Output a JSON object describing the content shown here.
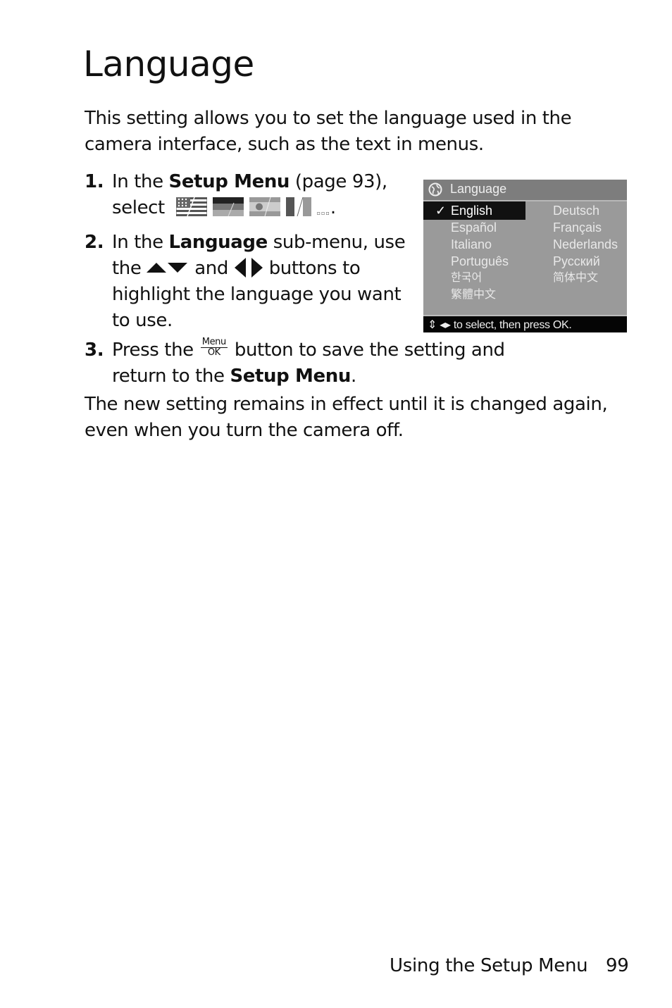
{
  "page": {
    "title": "Language",
    "intro": "This setting allows you to set the language used in the camera interface, such as the text in menus.",
    "steps": [
      {
        "num": "1.",
        "parts": {
          "a": "In the ",
          "b": "Setup Menu",
          "c": " (page 93),",
          "d": "select",
          "e": "."
        },
        "icons": [
          "us-flag-icon",
          "german-flag-icon",
          "japan-flag-icon",
          "french-flag-icon",
          "more-dots-icon"
        ]
      },
      {
        "num": "2.",
        "parts": {
          "a": "In the ",
          "b": "Language",
          "c": " sub-menu, use the",
          "d": "and",
          "e": "buttons to highlight the language you want to use."
        }
      },
      {
        "num": "3.",
        "parts": {
          "a": "Press the",
          "b": "button to save the setting and return to the ",
          "c": "Setup Menu",
          "d": "."
        },
        "button": {
          "top": "Menu",
          "bottom": "OK"
        }
      }
    ],
    "outro": "The new setting remains in effect until it is changed again, even when you turn the camera off."
  },
  "camera_screen": {
    "header": "Language",
    "selected_mark": "✓",
    "languages_left": [
      "English",
      "Español",
      "Italiano",
      "Português",
      "한국어",
      "繁體中文"
    ],
    "languages_right": [
      "Deutsch",
      "Français",
      "Nederlands",
      "Русский",
      "简体中文"
    ],
    "selected": "English",
    "footer": "⇕ ◂▸ to select, then press OK."
  },
  "footer": {
    "section": "Using the Setup Menu",
    "page_number": "99"
  }
}
